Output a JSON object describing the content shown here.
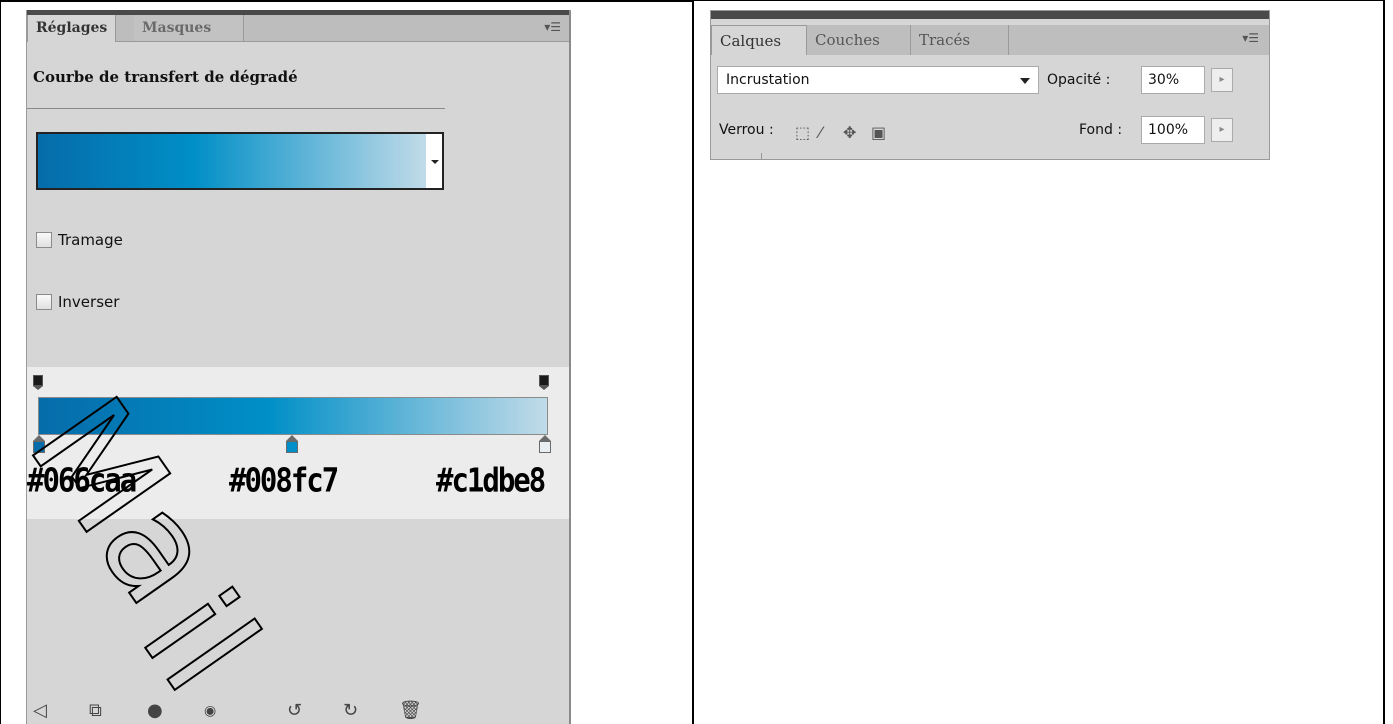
{
  "left_panel": {
    "tabs": [
      "Réglages",
      "Masques"
    ],
    "menu_icon": "☰",
    "title": "Courbe de transfert de dégradé",
    "checkboxes": [
      "Tramage",
      "Inverser"
    ],
    "color_stops": [
      "#066caa",
      "#008fc7",
      "#c1dbe8"
    ],
    "bottom_icons": [
      "back-arrow-icon",
      "expand-view-icon",
      "clip-layer-icon",
      "eye-icon",
      "view-previous-icon",
      "reset-icon",
      "trash-icon"
    ]
  },
  "right_panel": {
    "tabs": [
      "Calques",
      "Couches",
      "Tracés"
    ],
    "blend_mode": "Incrustation",
    "opacity_label": "Opacité :",
    "opacity_value": "30%",
    "lock_label": "Verrou :",
    "fill_label": "Fond :",
    "fill_value": "100%",
    "menu_icon": "☰"
  },
  "colors": {
    "stop1": "#066caa",
    "stop2": "#008fc7",
    "stop3": "#c1dbe8",
    "panel_bg": "#d6d6d6"
  }
}
